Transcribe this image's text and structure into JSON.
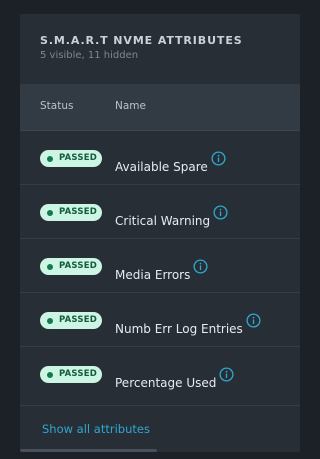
{
  "card": {
    "title": "S.M.A.R.T NVME ATTRIBUTES",
    "subtitle": "5 visible, 11 hidden"
  },
  "table": {
    "columns": [
      "Status",
      "Name"
    ],
    "rows": [
      {
        "status": "PASSED",
        "name": "Available Spare",
        "icon": "info-icon"
      },
      {
        "status": "PASSED",
        "name": "Critical Warning",
        "icon": "info-icon"
      },
      {
        "status": "PASSED",
        "name": "Media Errors",
        "icon": "info-icon"
      },
      {
        "status": "PASSED",
        "name": "Numb Err Log Entries",
        "icon": "info-icon"
      },
      {
        "status": "PASSED",
        "name": "Percentage Used",
        "icon": "info-icon"
      }
    ]
  },
  "footer": {
    "show_all_label": "Show all attributes"
  },
  "colors": {
    "passed_badge_bg": "#cdf5e4",
    "passed_dot": "#137a4f",
    "info_icon": "#2fa8cf",
    "link": "#2fa8cf"
  }
}
